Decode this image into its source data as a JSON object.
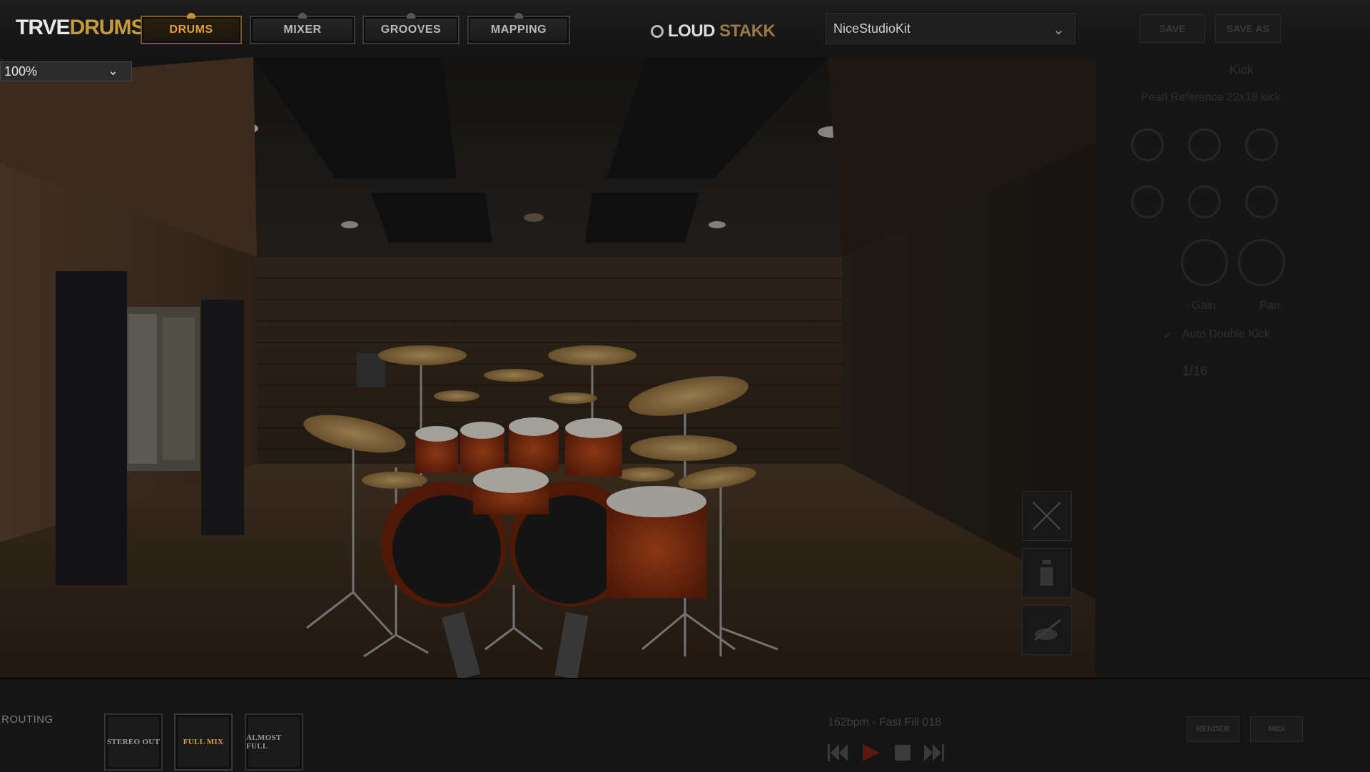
{
  "header": {
    "logo_part1": "TRVE",
    "logo_part2": "DRUMS",
    "tabs": [
      {
        "label": "DRUMS",
        "active": true
      },
      {
        "label": "MIXER",
        "active": false
      },
      {
        "label": "GROOVES",
        "active": false
      },
      {
        "label": "MAPPING",
        "active": false
      }
    ],
    "brand_part1": "LOUD",
    "brand_part2": "STAKK",
    "preset_value": "NiceStudioKit",
    "right_buttons": [
      "SAVE",
      "SAVE AS"
    ]
  },
  "zoom": {
    "value": "100%"
  },
  "right_panel": {
    "title": "Kick",
    "subtitle": "Pearl Reference 22x18 kick",
    "knob_labels": [
      "Gain",
      "Pan"
    ],
    "checkbox_label": "Auto Double Kick",
    "division": "1/16"
  },
  "bottom": {
    "routing_label": "ROUTING",
    "routing_options": [
      {
        "label": "STEREO OUT",
        "active": false
      },
      {
        "label": "FULL MIX",
        "active": true
      },
      {
        "label": "ALMOST FULL",
        "active": false
      }
    ],
    "groove_text": "162bpm - Fast Fill 018",
    "right_small_buttons": [
      "RENDER",
      "MIDI"
    ]
  },
  "colors": {
    "accent": "#e1a23c",
    "brand_gold": "#c79a3a",
    "background": "#121212"
  },
  "icons": [
    "close-icon",
    "info-icon",
    "drum-icon",
    "prev-icon",
    "play-icon",
    "stop-icon",
    "next-icon",
    "chevron-down-icon"
  ]
}
